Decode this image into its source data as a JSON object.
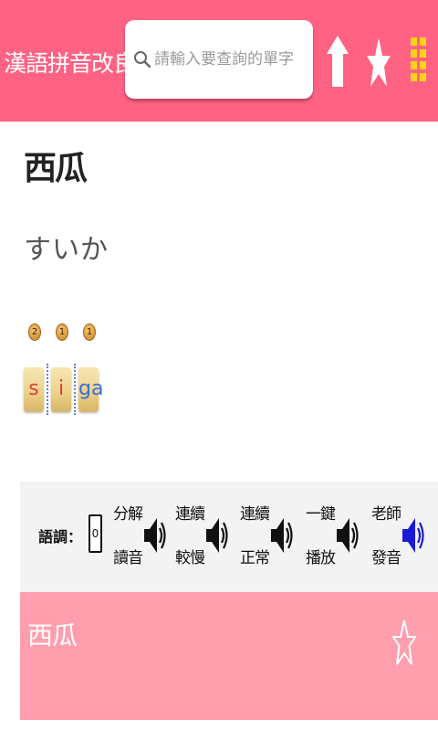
{
  "header": {
    "app_title": "漢語拼音改良版",
    "search_placeholder": "請輸入要查詢的單字",
    "background_color": "#ff6283",
    "icons": [
      "chevron-down-icon",
      "search-icon",
      "home-icon",
      "star-icon",
      "grid-menu-icon"
    ]
  },
  "word": {
    "title": "西瓜",
    "kana": "すいか"
  },
  "pinyin_tiles": [
    {
      "tone": "2",
      "syllable": "s",
      "color": "#d9403b"
    },
    {
      "tone": "1",
      "syllable": "i",
      "color": "#d9403b"
    },
    {
      "tone": "1",
      "syllable": "ga",
      "color": "#3b6fd6"
    }
  ],
  "audio_toolbar": {
    "tone_label": "語調：",
    "tone_value": "0",
    "buttons": [
      {
        "line1": "分解",
        "line2": "讀音",
        "icon": "speaker-icon",
        "color": "#111111"
      },
      {
        "line1": "連續",
        "line2": "較慢",
        "icon": "speaker-icon",
        "color": "#111111"
      },
      {
        "line1": "連續",
        "line2": "正常",
        "icon": "speaker-icon",
        "color": "#111111"
      },
      {
        "line1": "一鍵",
        "line2": "播放",
        "icon": "speaker-icon",
        "color": "#111111"
      },
      {
        "line1": "老師",
        "line2": "發音",
        "icon": "speaker-icon",
        "color": "#1a1ad6"
      }
    ]
  },
  "bottom_strip": {
    "word": "西瓜",
    "background_color": "#ff9fae",
    "icon": "star-outline-icon"
  }
}
